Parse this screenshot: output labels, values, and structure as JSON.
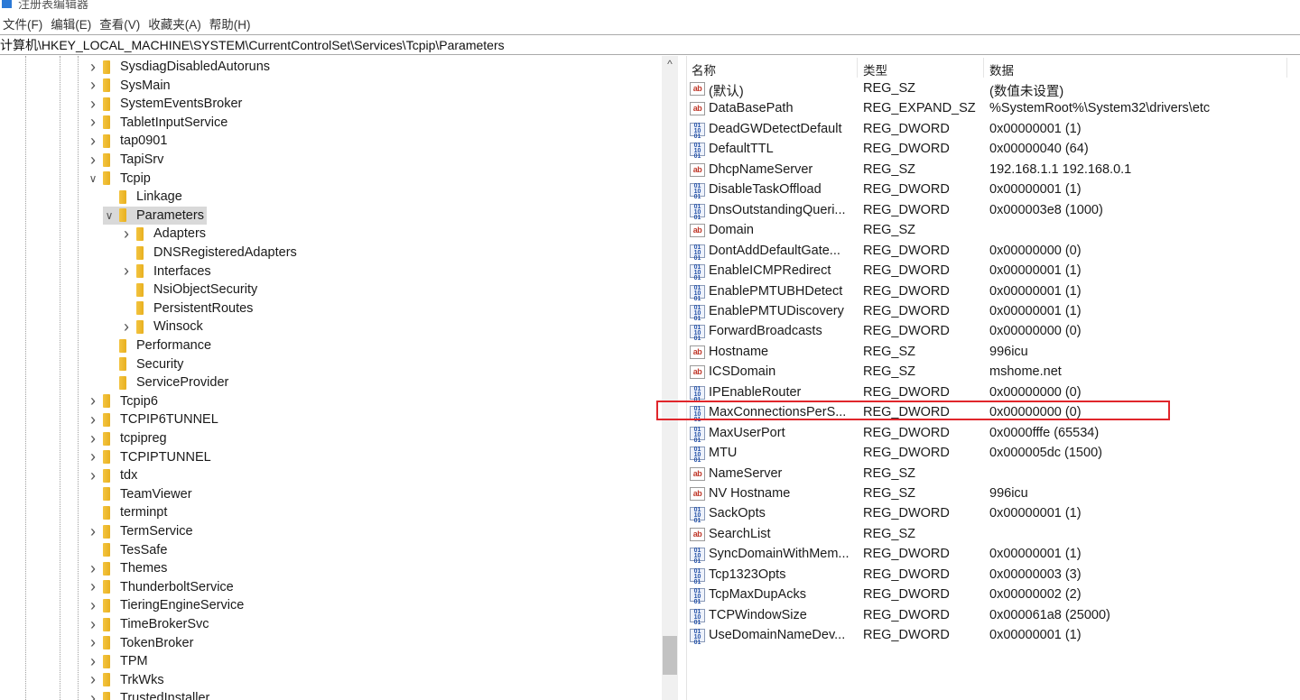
{
  "window": {
    "title": "注册表编辑器"
  },
  "menu": [
    "文件(F)",
    "编辑(E)",
    "查看(V)",
    "收藏夹(A)",
    "帮助(H)"
  ],
  "address": "计算机\\HKEY_LOCAL_MACHINE\\SYSTEM\\CurrentControlSet\\Services\\Tcpip\\Parameters",
  "tree": [
    {
      "label": "SysdiagDisabledAutoruns",
      "level": 0,
      "expander": "collapsed"
    },
    {
      "label": "SysMain",
      "level": 0,
      "expander": "collapsed"
    },
    {
      "label": "SystemEventsBroker",
      "level": 0,
      "expander": "collapsed"
    },
    {
      "label": "TabletInputService",
      "level": 0,
      "expander": "collapsed"
    },
    {
      "label": "tap0901",
      "level": 0,
      "expander": "collapsed"
    },
    {
      "label": "TapiSrv",
      "level": 0,
      "expander": "collapsed"
    },
    {
      "label": "Tcpip",
      "level": 0,
      "expander": "expanded"
    },
    {
      "label": "Linkage",
      "level": 1,
      "expander": "none"
    },
    {
      "label": "Parameters",
      "level": 1,
      "expander": "expanded",
      "selected": true
    },
    {
      "label": "Adapters",
      "level": 2,
      "expander": "collapsed"
    },
    {
      "label": "DNSRegisteredAdapters",
      "level": 2,
      "expander": "none"
    },
    {
      "label": "Interfaces",
      "level": 2,
      "expander": "collapsed"
    },
    {
      "label": "NsiObjectSecurity",
      "level": 2,
      "expander": "none"
    },
    {
      "label": "PersistentRoutes",
      "level": 2,
      "expander": "none"
    },
    {
      "label": "Winsock",
      "level": 2,
      "expander": "collapsed"
    },
    {
      "label": "Performance",
      "level": 1,
      "expander": "none"
    },
    {
      "label": "Security",
      "level": 1,
      "expander": "none"
    },
    {
      "label": "ServiceProvider",
      "level": 1,
      "expander": "none"
    },
    {
      "label": "Tcpip6",
      "level": 0,
      "expander": "collapsed"
    },
    {
      "label": "TCPIP6TUNNEL",
      "level": 0,
      "expander": "collapsed"
    },
    {
      "label": "tcpipreg",
      "level": 0,
      "expander": "collapsed"
    },
    {
      "label": "TCPIPTUNNEL",
      "level": 0,
      "expander": "collapsed"
    },
    {
      "label": "tdx",
      "level": 0,
      "expander": "collapsed"
    },
    {
      "label": "TeamViewer",
      "level": 0,
      "expander": "none"
    },
    {
      "label": "terminpt",
      "level": 0,
      "expander": "none"
    },
    {
      "label": "TermService",
      "level": 0,
      "expander": "collapsed"
    },
    {
      "label": "TesSafe",
      "level": 0,
      "expander": "none"
    },
    {
      "label": "Themes",
      "level": 0,
      "expander": "collapsed"
    },
    {
      "label": "ThunderboltService",
      "level": 0,
      "expander": "collapsed"
    },
    {
      "label": "TieringEngineService",
      "level": 0,
      "expander": "collapsed"
    },
    {
      "label": "TimeBrokerSvc",
      "level": 0,
      "expander": "collapsed"
    },
    {
      "label": "TokenBroker",
      "level": 0,
      "expander": "collapsed"
    },
    {
      "label": "TPM",
      "level": 0,
      "expander": "collapsed"
    },
    {
      "label": "TrkWks",
      "level": 0,
      "expander": "collapsed"
    },
    {
      "label": "TrustedInstaller",
      "level": 0,
      "expander": "collapsed"
    }
  ],
  "list": {
    "columns": [
      "名称",
      "类型",
      "数据"
    ],
    "rows": [
      {
        "icon": "string-value-icon",
        "name": "(默认)",
        "type": "REG_SZ",
        "data": "(数值未设置)"
      },
      {
        "icon": "string-value-icon",
        "name": "DataBasePath",
        "type": "REG_EXPAND_SZ",
        "data": "%SystemRoot%\\System32\\drivers\\etc"
      },
      {
        "icon": "binary-value-icon",
        "name": "DeadGWDetectDefault",
        "type": "REG_DWORD",
        "data": "0x00000001 (1)"
      },
      {
        "icon": "binary-value-icon",
        "name": "DefaultTTL",
        "type": "REG_DWORD",
        "data": "0x00000040 (64)"
      },
      {
        "icon": "string-value-icon",
        "name": "DhcpNameServer",
        "type": "REG_SZ",
        "data": "192.168.1.1 192.168.0.1"
      },
      {
        "icon": "binary-value-icon",
        "name": "DisableTaskOffload",
        "type": "REG_DWORD",
        "data": "0x00000001 (1)"
      },
      {
        "icon": "binary-value-icon",
        "name": "DnsOutstandingQueri...",
        "type": "REG_DWORD",
        "data": "0x000003e8 (1000)"
      },
      {
        "icon": "string-value-icon",
        "name": "Domain",
        "type": "REG_SZ",
        "data": ""
      },
      {
        "icon": "binary-value-icon",
        "name": "DontAddDefaultGate...",
        "type": "REG_DWORD",
        "data": "0x00000000 (0)"
      },
      {
        "icon": "binary-value-icon",
        "name": "EnableICMPRedirect",
        "type": "REG_DWORD",
        "data": "0x00000001 (1)"
      },
      {
        "icon": "binary-value-icon",
        "name": "EnablePMTUBHDetect",
        "type": "REG_DWORD",
        "data": "0x00000001 (1)"
      },
      {
        "icon": "binary-value-icon",
        "name": "EnablePMTUDiscovery",
        "type": "REG_DWORD",
        "data": "0x00000001 (1)"
      },
      {
        "icon": "binary-value-icon",
        "name": "ForwardBroadcasts",
        "type": "REG_DWORD",
        "data": "0x00000000 (0)"
      },
      {
        "icon": "string-value-icon",
        "name": "Hostname",
        "type": "REG_SZ",
        "data": "996icu"
      },
      {
        "icon": "string-value-icon",
        "name": "ICSDomain",
        "type": "REG_SZ",
        "data": "mshome.net"
      },
      {
        "icon": "binary-value-icon",
        "name": "IPEnableRouter",
        "type": "REG_DWORD",
        "data": "0x00000000 (0)"
      },
      {
        "icon": "binary-value-icon",
        "name": "MaxConnectionsPerS...",
        "type": "REG_DWORD",
        "data": "0x00000000 (0)",
        "highlighted": true
      },
      {
        "icon": "binary-value-icon",
        "name": "MaxUserPort",
        "type": "REG_DWORD",
        "data": "0x0000fffe (65534)"
      },
      {
        "icon": "binary-value-icon",
        "name": "MTU",
        "type": "REG_DWORD",
        "data": "0x000005dc (1500)"
      },
      {
        "icon": "string-value-icon",
        "name": "NameServer",
        "type": "REG_SZ",
        "data": ""
      },
      {
        "icon": "string-value-icon",
        "name": "NV Hostname",
        "type": "REG_SZ",
        "data": "996icu"
      },
      {
        "icon": "binary-value-icon",
        "name": "SackOpts",
        "type": "REG_DWORD",
        "data": "0x00000001 (1)"
      },
      {
        "icon": "string-value-icon",
        "name": "SearchList",
        "type": "REG_SZ",
        "data": ""
      },
      {
        "icon": "binary-value-icon",
        "name": "SyncDomainWithMem...",
        "type": "REG_DWORD",
        "data": "0x00000001 (1)"
      },
      {
        "icon": "binary-value-icon",
        "name": "Tcp1323Opts",
        "type": "REG_DWORD",
        "data": "0x00000003 (3)"
      },
      {
        "icon": "binary-value-icon",
        "name": "TcpMaxDupAcks",
        "type": "REG_DWORD",
        "data": "0x00000002 (2)"
      },
      {
        "icon": "binary-value-icon",
        "name": "TCPWindowSize",
        "type": "REG_DWORD",
        "data": "0x000061a8 (25000)"
      },
      {
        "icon": "binary-value-icon",
        "name": "UseDomainNameDev...",
        "type": "REG_DWORD",
        "data": "0x00000001 (1)"
      }
    ]
  },
  "colors": {
    "highlight_box": "#e0262b",
    "selection": "#d9d9d9",
    "folder": "#f3c440"
  }
}
